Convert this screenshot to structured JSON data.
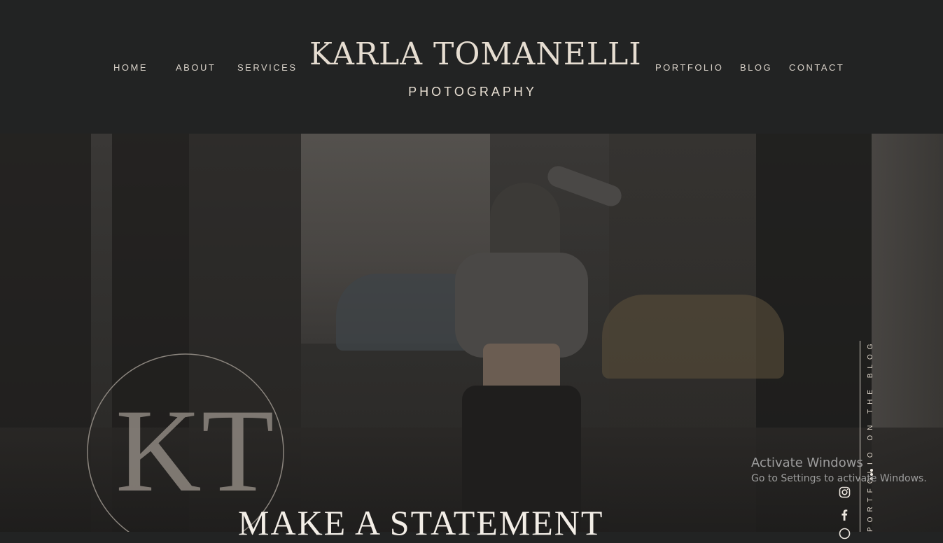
{
  "brand": {
    "name": "KARLA TOMANELLI",
    "subtitle": "PHOTOGRAPHY"
  },
  "nav": {
    "home": "HOME",
    "about": "ABOUT",
    "services": "SERVICES",
    "portfolio": "PORTFOLIO",
    "blog": "BLOG",
    "contact": "CONTACT"
  },
  "hero": {
    "headline": "MAKE A STATEMENT",
    "monogram": "KT",
    "side_text": "PORTFOLIO ON THE BLOG"
  },
  "social": {
    "icons": [
      "instagram-icon",
      "facebook-icon",
      "pinterest-icon"
    ]
  },
  "windows_notice": {
    "title": "Activate Windows",
    "subtitle": "Go to Settings to activate Windows."
  },
  "colors": {
    "background": "#222323",
    "text": "#e6ddd1"
  }
}
